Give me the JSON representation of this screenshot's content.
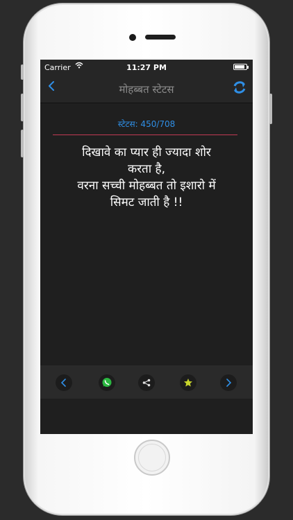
{
  "statusbar": {
    "carrier": "Carrier",
    "time": "11:27 PM",
    "battery_level": 0.9
  },
  "navbar": {
    "title": "मोहब्बत स्टेटस",
    "back_icon": "chevron-left-icon",
    "refresh_icon": "refresh-icon"
  },
  "status": {
    "counter": "स्टेटस: 450/708",
    "text": "दिखावे का प्यार ही ज्यादा शोर\nकरता है,\nवरना सच्ची मोहब्बत तो इशारो में\nसिमट जाती है !!"
  },
  "toolbar": {
    "buttons": [
      "previous-icon",
      "whatsapp-icon",
      "share-icon",
      "favorite-star-icon",
      "next-icon"
    ]
  },
  "colors": {
    "accent": "#2f8fe6",
    "divider": "#c23a55",
    "whatsapp": "#2bb741",
    "star": "#c8d62b"
  }
}
